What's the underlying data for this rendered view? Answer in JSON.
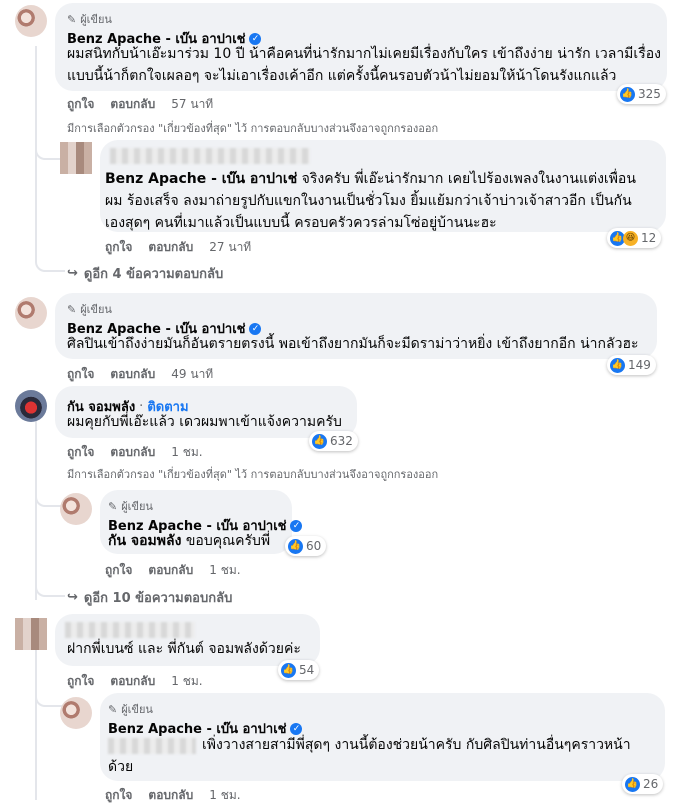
{
  "comments": [
    {
      "badge": "ผู้เขียน",
      "name": "Benz Apache - เบ๊น อาปาเช่",
      "text": "ผมสนิทกับน้าเอ๊ะมาร่วม 10 ปี น้าคือคนที่น่ารักมากไม่เคยมีเรื่องกับใคร เข้าถึงง่าย น่ารัก เวลามีเรื่องแบบนี้น้าก็ตกใจเผลอๆ จะไม่เอาเรื่องเค้าอีก แต่ครั้งนี้คนรอบตัวน้าไม่ยอมให้น้าโดนรังแกแล้ว",
      "like": "ถูกใจ",
      "reply": "ตอบกลับ",
      "time": "57 นาที",
      "reactions": "325"
    },
    {
      "name_prefix": "Benz Apache - เบ๊น อาปาเช่",
      "text": "จริงครับ พี่เอ๊ะน่ารักมาก เคยไปร้องเพลงในงานแต่งเพื่อนผม ร้องเสร็จ ลงมาถ่ายรูปกับแขกในงานเป็นชั่วโมง ยิ้มแย้มกว่าเจ้าบ่าวเจ้าสาวอีก เป็นกันเองสุดๆ คนที่เมาแล้วเป็นแบบนี้ ครอบครัวควรล่ามโซ่อยู่บ้านนะฮะ",
      "like": "ถูกใจ",
      "reply": "ตอบกลับ",
      "time": "27 นาที",
      "reactions": "12"
    },
    {
      "badge": "ผู้เขียน",
      "name": "Benz Apache - เบ๊น อาปาเช่",
      "text": "ศิลปินเข้าถึงง่ายมันก็อันตรายตรงนี้ พอเข้าถึงยากมันก็จะมีดราม่าว่าหยิ่ง เข้าถึงยากอีก น่ากลัวฮะ",
      "like": "ถูกใจ",
      "reply": "ตอบกลับ",
      "time": "49 นาที",
      "reactions": "149"
    },
    {
      "name": "กัน จอมพลัง",
      "follow": "ติดตาม",
      "text": "ผมคุยกับพี่เอ๊ะแล้ว เดวผมพาเข้าแจ้งความครับ",
      "like": "ถูกใจ",
      "reply": "ตอบกลับ",
      "time": "1 ชม.",
      "reactions": "632"
    },
    {
      "badge": "ผู้เขียน",
      "name": "Benz Apache - เบ๊น อาปาเช่",
      "mention": "กัน จอมพลัง",
      "text": "ขอบคุณครับพี่",
      "like": "ถูกใจ",
      "reply": "ตอบกลับ",
      "time": "1 ชม.",
      "reactions": "60"
    },
    {
      "text": "ฝากพี่เบนซ์ และ พี่กันต์ จอมพลังด้วยค่ะ",
      "like": "ถูกใจ",
      "reply": "ตอบกลับ",
      "time": "1 ชม.",
      "reactions": "54"
    },
    {
      "badge": "ผู้เขียน",
      "name": "Benz Apache - เบ๊น อาปาเช่",
      "text_line1": "เพิ่งวางสายสามีพี่สุดๆ งานนี้ต้องช่วยน้าครับ กับศิลปินท่านอื่นๆคราวหน้า",
      "text_line2": "ด้วย",
      "like": "ถูกใจ",
      "reply": "ตอบกลับ",
      "time": "1 ชม.",
      "reactions": "26"
    }
  ],
  "filter_note": "มีการเลือกตัวกรอง \"เกี่ยวข้องที่สุด\" ไว้ การตอบกลับบางส่วนจึงอาจถูกกรองออก",
  "more_replies_1": "ดูอีก 4 ข้อความตอบกลับ",
  "more_replies_2": "ดูอีก 10 ข้อความตอบกลับ",
  "icons": {
    "author": "pencil-icon",
    "verified": "verified-badge-icon",
    "like": "thumbs-up-icon",
    "haha": "haha-icon",
    "reply_arrow": "reply-arrow-icon"
  },
  "colors": {
    "accent": "#1877f2",
    "bubble": "#f0f2f5",
    "muted": "#65676b"
  }
}
